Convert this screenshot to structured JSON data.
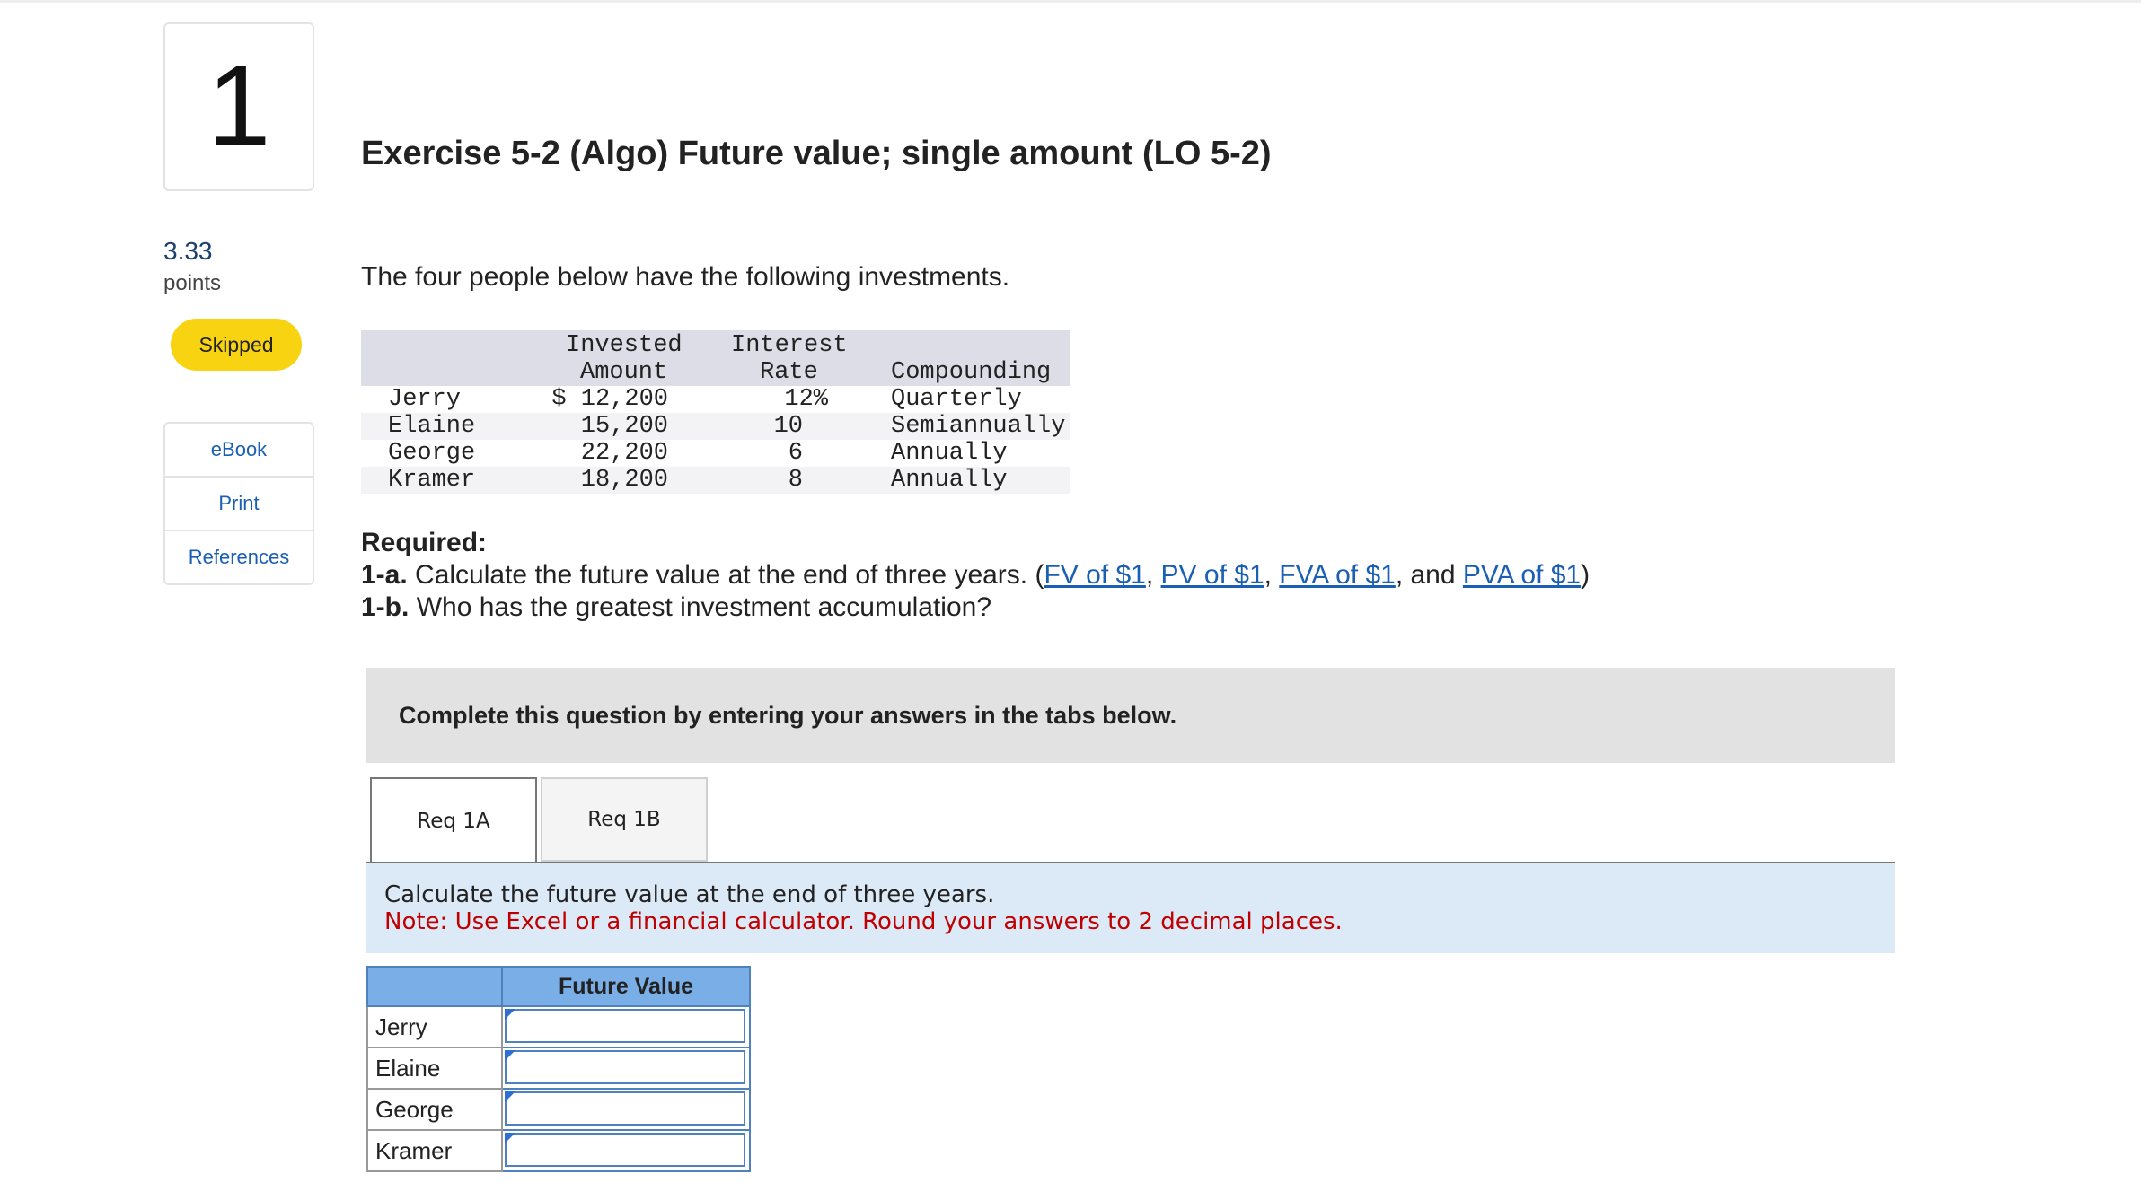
{
  "question": {
    "number": "1",
    "points_value": "3.33",
    "points_label": "points",
    "status": "Skipped"
  },
  "tools": [
    "eBook",
    "Print",
    "References"
  ],
  "title": "Exercise 5-2 (Algo) Future value; single amount (LO 5-2)",
  "intro": "The four people below have the following investments.",
  "investments": {
    "headers": {
      "amount_1": "Invested",
      "amount_2": "Amount",
      "rate_1": "Interest",
      "rate_2": "Rate",
      "compounding": "Compounding"
    },
    "rows": [
      {
        "name": "Jerry",
        "amount": "$ 12,200",
        "rate": "12%",
        "compounding": "Quarterly"
      },
      {
        "name": "Elaine",
        "amount": "15,200",
        "rate": "10",
        "compounding": "Semiannually"
      },
      {
        "name": "George",
        "amount": "22,200",
        "rate": "6",
        "compounding": "Annually"
      },
      {
        "name": "Kramer",
        "amount": "18,200",
        "rate": "8",
        "compounding": "Annually"
      }
    ]
  },
  "required": {
    "heading": "Required:",
    "line_1a_prefix": "1-a.",
    "line_1a_text": "Calculate the future value at the end of three years. (",
    "links": [
      "FV of $1",
      "PV of $1",
      "FVA of $1",
      "PVA of $1"
    ],
    "sep_comma": ", ",
    "sep_and": ", and ",
    "close": ")",
    "line_1b_prefix": "1-b.",
    "line_1b_text": "Who has the greatest investment accumulation?"
  },
  "instruction": "Complete this question by entering your answers in the tabs below.",
  "tabs": [
    {
      "label": "Req 1A",
      "active": true
    },
    {
      "label": "Req 1B",
      "active": false
    }
  ],
  "prompt": {
    "text": "Calculate the future value at the end of three years.",
    "note": "Note: Use Excel or a financial calculator. Round your answers to 2 decimal places."
  },
  "answer_table": {
    "header": "Future Value",
    "rows": [
      {
        "label": "Jerry",
        "value": ""
      },
      {
        "label": "Elaine",
        "value": ""
      },
      {
        "label": "George",
        "value": ""
      },
      {
        "label": "Kramer",
        "value": ""
      }
    ]
  },
  "colors": {
    "badge": "#f8d312",
    "link": "#1a5fb4",
    "note": "#c00000",
    "answer_header": "#7aaee6",
    "prompt_bg": "#dceaf7"
  }
}
